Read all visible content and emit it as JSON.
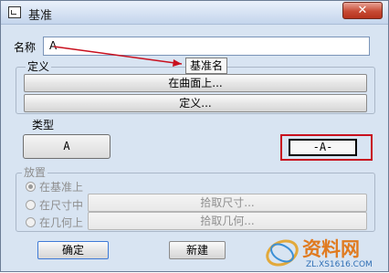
{
  "window": {
    "title": "基准",
    "close_label": "✕"
  },
  "name": {
    "label": "名称",
    "value": "A"
  },
  "tooltip": "基准名",
  "define_group": {
    "label": "定义",
    "on_surface_button": "在曲面上...",
    "define_button": "定义..."
  },
  "type_group": {
    "label": "类型",
    "options": [
      "A",
      "-A-"
    ]
  },
  "placement_group": {
    "label": "放置",
    "options": [
      {
        "label": "在基准上",
        "selected": true,
        "button": ""
      },
      {
        "label": "在尺寸中",
        "selected": false,
        "button": "拾取尺寸..."
      },
      {
        "label": "在几何上",
        "selected": false,
        "button": "拾取几何..."
      }
    ]
  },
  "footer": {
    "ok_button": "确定",
    "new_button": "新建"
  },
  "watermark": {
    "brand": "资料网",
    "url": "ZL.XS1616.COM"
  }
}
